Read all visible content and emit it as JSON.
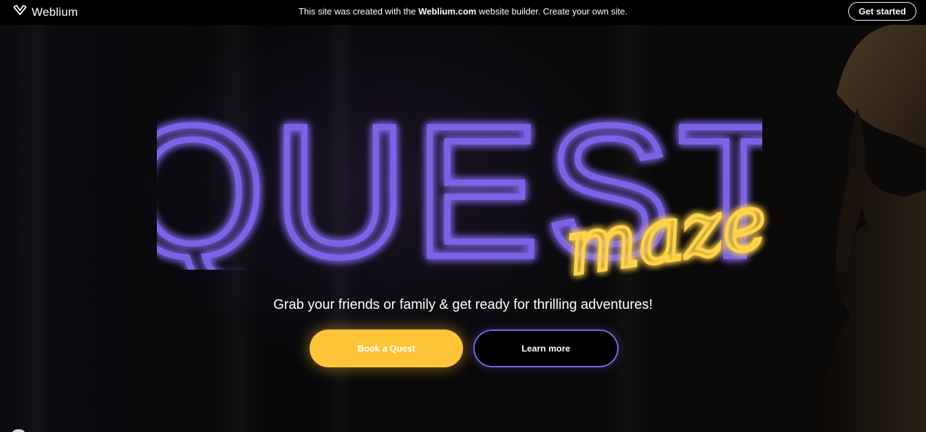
{
  "topbar": {
    "brand_name": "Weblium",
    "notice_prefix": "This site was created with the ",
    "notice_brand": "Weblium.com",
    "notice_suffix": " website builder. Create your own site.",
    "cta_label": "Get started"
  },
  "hero": {
    "title": "QUEST",
    "subtitle": "maze",
    "tagline": "Grab your friends or family & get ready for thrilling adventures!",
    "primary_button": "Book a Quest",
    "secondary_button": "Learn more"
  },
  "colors": {
    "neon_purple": "#7b63e6",
    "neon_yellow": "#ffc437",
    "background": "#000000"
  },
  "icons": [
    "weblium-logo-icon"
  ]
}
